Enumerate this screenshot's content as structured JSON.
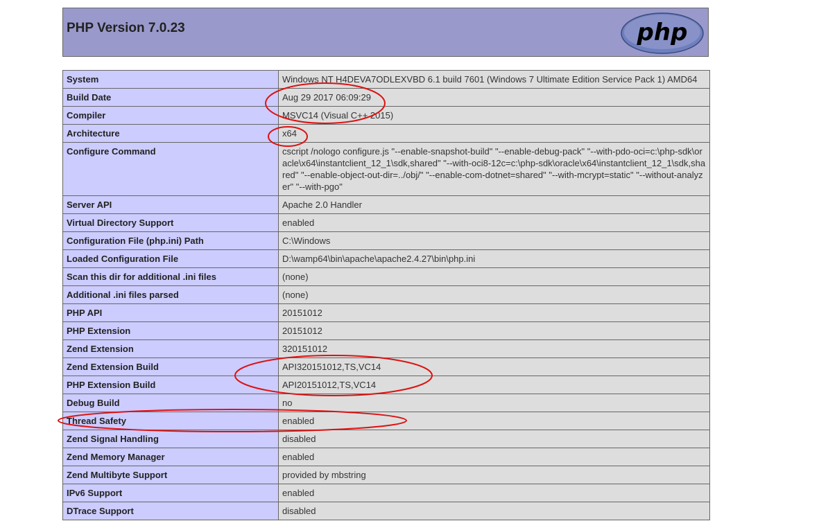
{
  "header": {
    "title": "PHP Version 7.0.23",
    "logo_text": "php",
    "background": "#9999cc"
  },
  "colors": {
    "key_cell": "#ccccff",
    "value_cell": "#dddddd",
    "annotation": "#dd1111"
  },
  "rows": [
    {
      "key": "System",
      "value": "Windows NT H4DEVA7ODLEXVBD 6.1 build 7601 (Windows 7 Ultimate Edition Service Pack 1) AMD64"
    },
    {
      "key": "Build Date",
      "value": "Aug 29 2017 06:09:29"
    },
    {
      "key": "Compiler",
      "value": "MSVC14 (Visual C++ 2015)"
    },
    {
      "key": "Architecture",
      "value": "x64"
    },
    {
      "key": "Configure Command",
      "value": "cscript /nologo configure.js \"--enable-snapshot-build\" \"--enable-debug-pack\" \"--with-pdo-oci=c:\\php-sdk\\oracle\\x64\\instantclient_12_1\\sdk,shared\" \"--with-oci8-12c=c:\\php-sdk\\oracle\\x64\\instantclient_12_1\\sdk,shared\" \"--enable-object-out-dir=../obj/\" \"--enable-com-dotnet=shared\" \"--with-mcrypt=static\" \"--without-analyzer\" \"--with-pgo\""
    },
    {
      "key": "Server API",
      "value": "Apache 2.0 Handler"
    },
    {
      "key": "Virtual Directory Support",
      "value": "enabled"
    },
    {
      "key": "Configuration File (php.ini) Path",
      "value": "C:\\Windows"
    },
    {
      "key": "Loaded Configuration File",
      "value": "D:\\wamp64\\bin\\apache\\apache2.4.27\\bin\\php.ini"
    },
    {
      "key": "Scan this dir for additional .ini files",
      "value": "(none)"
    },
    {
      "key": "Additional .ini files parsed",
      "value": "(none)"
    },
    {
      "key": "PHP API",
      "value": "20151012"
    },
    {
      "key": "PHP Extension",
      "value": "20151012"
    },
    {
      "key": "Zend Extension",
      "value": "320151012"
    },
    {
      "key": "Zend Extension Build",
      "value": "API320151012,TS,VC14"
    },
    {
      "key": "PHP Extension Build",
      "value": "API20151012,TS,VC14"
    },
    {
      "key": "Debug Build",
      "value": "no"
    },
    {
      "key": "Thread Safety",
      "value": "enabled"
    },
    {
      "key": "Zend Signal Handling",
      "value": "disabled"
    },
    {
      "key": "Zend Memory Manager",
      "value": "enabled"
    },
    {
      "key": "Zend Multibyte Support",
      "value": "provided by mbstring"
    },
    {
      "key": "IPv6 Support",
      "value": "enabled"
    },
    {
      "key": "DTrace Support",
      "value": "disabled"
    }
  ]
}
